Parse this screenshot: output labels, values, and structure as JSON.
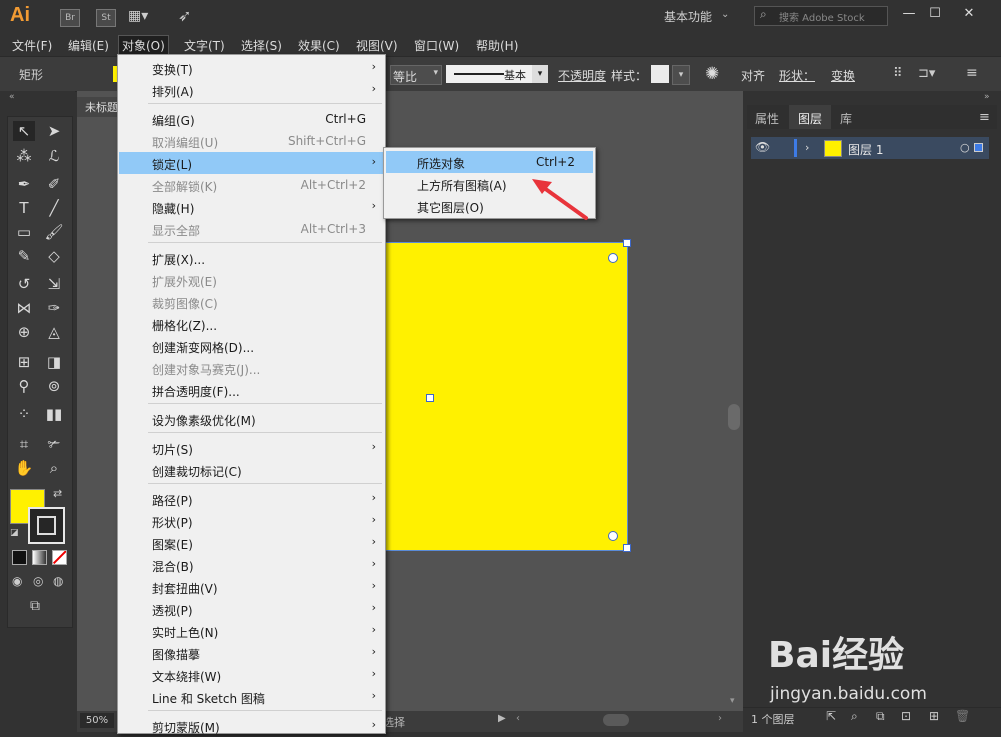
{
  "app": {
    "logo": "Ai",
    "bridge": "Br",
    "stock_app": "St",
    "workspace": "基本功能",
    "search_placeholder": "搜索 Adobe Stock"
  },
  "menubar": {
    "items": [
      "文件(F)",
      "编辑(E)",
      "对象(O)",
      "文字(T)",
      "选择(S)",
      "效果(C)",
      "视图(V)",
      "窗口(W)",
      "帮助(H)"
    ],
    "active": "对象(O)"
  },
  "controlbar": {
    "shape_label": "矩形",
    "ratio": "等比",
    "stroke_profile": "基本",
    "opacity_label": "不透明度",
    "style_label": "样式：",
    "align_label": "对齐",
    "shape2_label": "形状：",
    "transform_label": "变换"
  },
  "document": {
    "tab_title": "未标题",
    "zoom": "50%",
    "status_text": "选择"
  },
  "object_menu": {
    "items": [
      {
        "label": "变换(T)",
        "shortcut": "",
        "submenu": true,
        "disabled": false
      },
      {
        "label": "排列(A)",
        "shortcut": "",
        "submenu": true,
        "disabled": false
      },
      {
        "label": "编组(G)",
        "shortcut": "Ctrl+G",
        "submenu": false,
        "disabled": false
      },
      {
        "label": "取消编组(U)",
        "shortcut": "Shift+Ctrl+G",
        "submenu": false,
        "disabled": true
      },
      {
        "label": "锁定(L)",
        "shortcut": "",
        "submenu": true,
        "disabled": false,
        "highlighted": true
      },
      {
        "label": "全部解锁(K)",
        "shortcut": "Alt+Ctrl+2",
        "submenu": false,
        "disabled": true
      },
      {
        "label": "隐藏(H)",
        "shortcut": "",
        "submenu": true,
        "disabled": false
      },
      {
        "label": "显示全部",
        "shortcut": "Alt+Ctrl+3",
        "submenu": false,
        "disabled": true
      },
      {
        "label": "扩展(X)...",
        "shortcut": "",
        "submenu": false,
        "disabled": false
      },
      {
        "label": "扩展外观(E)",
        "shortcut": "",
        "submenu": false,
        "disabled": true
      },
      {
        "label": "裁剪图像(C)",
        "shortcut": "",
        "submenu": false,
        "disabled": true
      },
      {
        "label": "栅格化(Z)...",
        "shortcut": "",
        "submenu": false,
        "disabled": false
      },
      {
        "label": "创建渐变网格(D)...",
        "shortcut": "",
        "submenu": false,
        "disabled": false
      },
      {
        "label": "创建对象马赛克(J)...",
        "shortcut": "",
        "submenu": false,
        "disabled": true
      },
      {
        "label": "拼合透明度(F)...",
        "shortcut": "",
        "submenu": false,
        "disabled": false
      },
      {
        "label": "设为像素级优化(M)",
        "shortcut": "",
        "submenu": false,
        "disabled": false
      },
      {
        "label": "切片(S)",
        "shortcut": "",
        "submenu": true,
        "disabled": false
      },
      {
        "label": "创建裁切标记(C)",
        "shortcut": "",
        "submenu": false,
        "disabled": false
      },
      {
        "label": "路径(P)",
        "shortcut": "",
        "submenu": true,
        "disabled": false
      },
      {
        "label": "形状(P)",
        "shortcut": "",
        "submenu": true,
        "disabled": false
      },
      {
        "label": "图案(E)",
        "shortcut": "",
        "submenu": true,
        "disabled": false
      },
      {
        "label": "混合(B)",
        "shortcut": "",
        "submenu": true,
        "disabled": false
      },
      {
        "label": "封套扭曲(V)",
        "shortcut": "",
        "submenu": true,
        "disabled": false
      },
      {
        "label": "透视(P)",
        "shortcut": "",
        "submenu": true,
        "disabled": false
      },
      {
        "label": "实时上色(N)",
        "shortcut": "",
        "submenu": true,
        "disabled": false
      },
      {
        "label": "图像描摹",
        "shortcut": "",
        "submenu": true,
        "disabled": false
      },
      {
        "label": "文本绕排(W)",
        "shortcut": "",
        "submenu": true,
        "disabled": false
      },
      {
        "label": "Line 和 Sketch 图稿",
        "shortcut": "",
        "submenu": true,
        "disabled": false
      },
      {
        "label": "剪切蒙版(M)",
        "shortcut": "",
        "submenu": true,
        "disabled": false
      }
    ]
  },
  "lock_submenu": {
    "items": [
      {
        "label": "所选对象",
        "shortcut": "Ctrl+2",
        "highlighted": true
      },
      {
        "label": "上方所有图稿(A)",
        "shortcut": ""
      },
      {
        "label": "其它图层(O)",
        "shortcut": ""
      }
    ]
  },
  "panels": {
    "tabs": [
      "属性",
      "图层",
      "库"
    ],
    "active_tab": "图层",
    "layer_name": "图层 1",
    "layer_count": "1 个图层"
  },
  "colors": {
    "fill": "#fff100",
    "menu_highlight": "#91c9f7",
    "annotation_arrow": "#e8343b"
  },
  "watermark": {
    "brand": "Bai经验",
    "url": "jingyan.baidu.com"
  }
}
